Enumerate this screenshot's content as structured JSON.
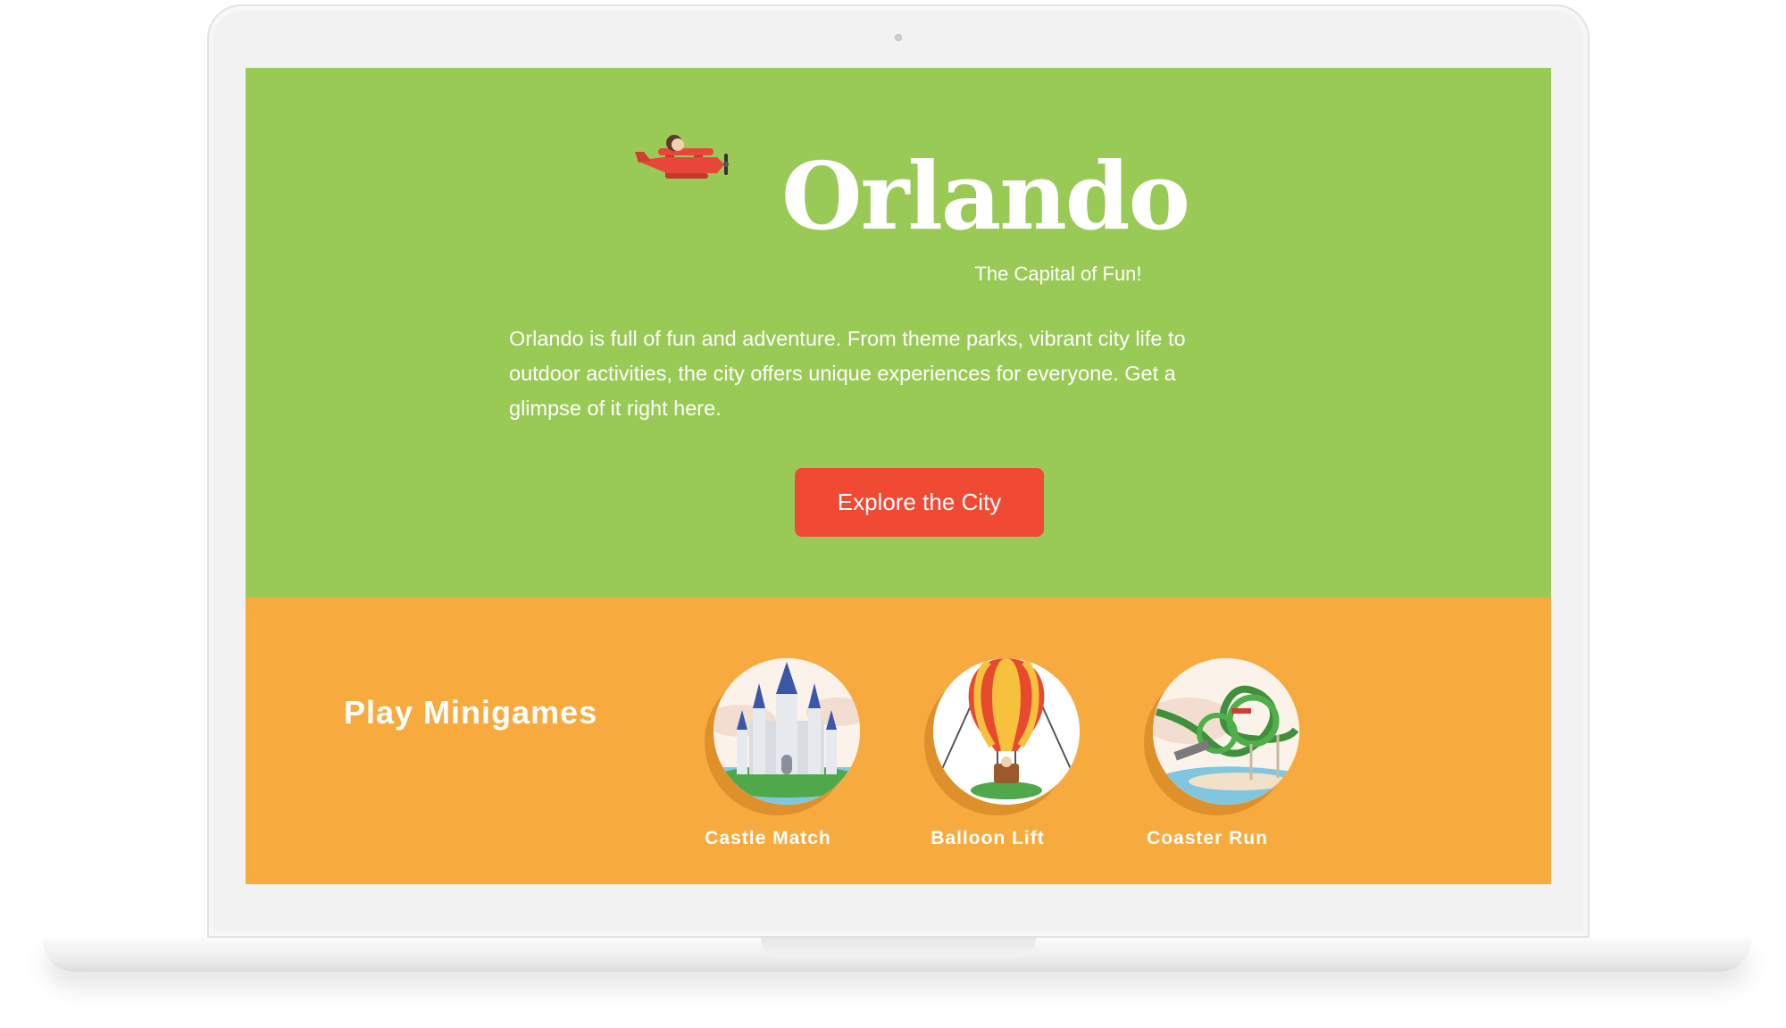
{
  "site": {
    "logo_text": "Orlando",
    "tagline": "The Capital of Fun!",
    "intro_line_1": "Orlando is full of fun and adventure. From theme parks, vibrant city life to",
    "intro_line_2": "outdoor activities, the city offers unique experiences for everyone. Get a",
    "intro_line_3": "glimpse of it right here.",
    "cta_label": "Explore the City"
  },
  "minigames": {
    "title": "Play Minigames",
    "items": [
      {
        "label": "Castle Match",
        "icon": "castle-icon"
      },
      {
        "label": "Balloon Lift",
        "icon": "hot-air-balloon-icon"
      },
      {
        "label": "Coaster Run",
        "icon": "roller-coaster-icon"
      }
    ]
  },
  "colors": {
    "hero_bg": "#9aca56",
    "games_bg": "#f7ab3f",
    "cta_bg": "#f04a34",
    "text": "#ffffff"
  }
}
